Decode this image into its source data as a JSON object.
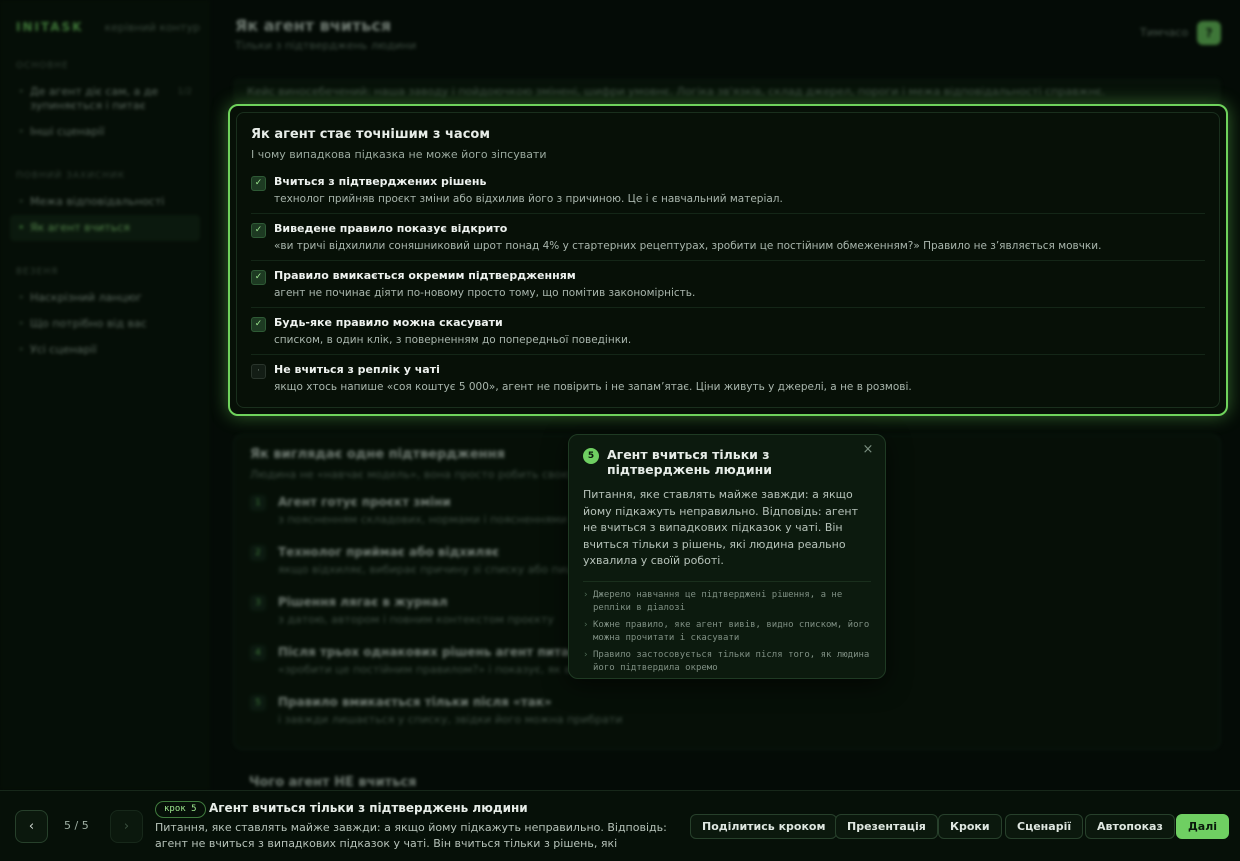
{
  "sidebar": {
    "logo": "INITASK",
    "logo_sub": "керівний контур",
    "sections": [
      {
        "title": "ОСНОВНЕ",
        "items": [
          {
            "label": "Де агент діє сам, а де зупиняється і питає",
            "badge": "1/2"
          },
          {
            "label": "Інші сценарії"
          }
        ]
      },
      {
        "title": "ПОВНИЙ ЗАХИСНИК",
        "items": [
          {
            "label": "Межа відповідальності"
          },
          {
            "label": "Як агент вчиться",
            "active": true
          }
        ]
      },
      {
        "title": "ВЕЗЕНЯ",
        "items": [
          {
            "label": "Наскрізний ланцюг"
          },
          {
            "label": "Що потрібно від вас"
          },
          {
            "label": "Усі сценарії"
          }
        ]
      }
    ]
  },
  "header": {
    "title": "Як агент вчиться",
    "subtitle": "Тільки з підтверджень людини",
    "lang_label": "Тимчасо",
    "avatar_label": "?"
  },
  "intro": "Кейс виносебечений: наша заводу і пойдоючкою змінені, шифри умовнє. Логіка зв'язків, склад джерел, пороги і межа відповідальності справжнє.",
  "highlight_card": {
    "title": "Як агент стає точнішим з часом",
    "subtitle": "І чому випадкова підказка не може його зіпсувати",
    "items": [
      {
        "checked": true,
        "title": "Вчиться з підтверджених рішень",
        "desc": "технолог прийняв проєкт зміни або відхилив його з причиною. Це і є навчальний матеріал."
      },
      {
        "checked": true,
        "title": "Виведене правило показує відкрито",
        "desc": "«ви тричі відхилили соняшниковий шрот понад 4% у стартерних рецептурах, зробити це постійним обмеженням?» Правило не з’являється мовчки."
      },
      {
        "checked": true,
        "title": "Правило вмикається окремим підтвердженням",
        "desc": "агент не починає діяти по-новому просто тому, що помітив закономірність."
      },
      {
        "checked": true,
        "title": "Будь-яке правило можна скасувати",
        "desc": "списком, в один клік, з поверненням до попередньої поведінки."
      },
      {
        "checked": false,
        "title": "Не вчиться з реплік у чаті",
        "desc": "якщо хтось напише «соя коштує 5 000», агент не повірить і не запам’ятає. Ціни живуть у джерелі, а не в розмові."
      }
    ]
  },
  "bg_card": {
    "title": "Як виглядає одне підтвердження",
    "subtitle": "Людина не «навчає модель», вона просто робить свою роботу",
    "steps": [
      {
        "num": "1",
        "title": "Агент готує проєкт зміни",
        "desc": "з поясненням складових, нормами і поясненнями кожної зміни"
      },
      {
        "num": "2",
        "title": "Технолог приймає або відхиляє",
        "desc": "якщо відхиляє, вибирає причину зі списку або пише своїми словами"
      },
      {
        "num": "3",
        "title": "Рішення лягає в журнал",
        "desc": "з датою, автором і повним контекстом проєкту"
      },
      {
        "num": "4",
        "title": "Після трьох однакових рішень агент питає",
        "desc": "«зробити це постійним правилом?» і показує, як воно звучатиме"
      },
      {
        "num": "5",
        "title": "Правило вмикається тільки після «так»",
        "desc": "і завжди лишається у списку, звідки його можна прибрати"
      }
    ],
    "next_title": "Чого агент НЕ вчиться"
  },
  "popover": {
    "num": "5",
    "title": "Агент вчиться тільки з підтверджень людини",
    "close": "×",
    "body": "Питання, яке ставлять майже завжди: а якщо йому підкажуть неправильно. Відповідь: агент не вчиться з випадкових підказок у чаті. Він вчиться тільки з рішень, які людина реально ухвалила у своїй роботі.",
    "bullets": [
      "Джерело навчання це підтверджені рішення, а не репліки в діалозі",
      "Кожне правило, яке агент вивів, видно списком, його можна прочитати і скасувати",
      "Правило застосовується тільки після того, як людина його підтвердила окремо"
    ]
  },
  "bottom_bar": {
    "prev": "‹",
    "next_arrow": "›",
    "counter": "5 / 5",
    "step_badge": "крок 5",
    "step_title": "Агент вчиться тільки з підтверджень людини",
    "step_desc": "Питання, яке ставлять майже завжди: а якщо йому підкажуть неправильно. Відповідь: агент не вчиться з випадкових підказок у чаті. Він вчиться тільки з рішень, які людина...",
    "actions": {
      "share": "Поділитись кроком",
      "present": "Презентація",
      "steps": "Кроки",
      "scenarios": "Сценарії",
      "autoplay": "Автопоказ",
      "next": "Далі"
    }
  },
  "colors": {
    "accent": "#6fcf62",
    "background": "#040b06"
  }
}
